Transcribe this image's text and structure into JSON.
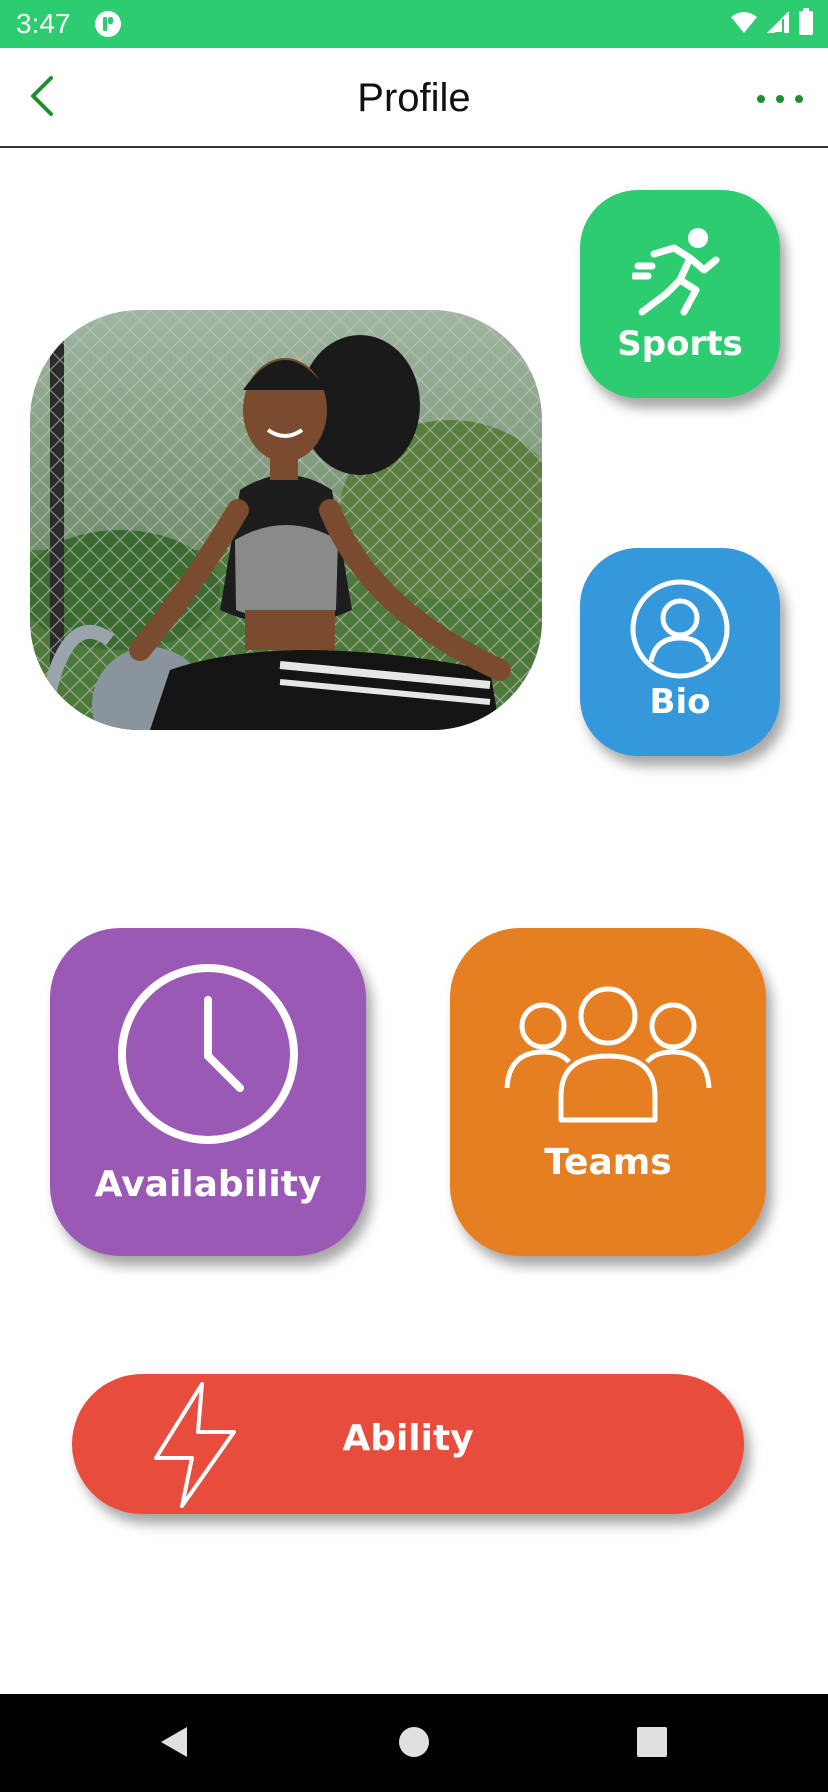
{
  "status_bar": {
    "time": "3:47",
    "bg_color": "#2ecc71",
    "icons": [
      "app-notification-icon",
      "wifi-icon",
      "cellular-signal-icon",
      "battery-icon"
    ]
  },
  "app_bar": {
    "title": "Profile",
    "back_icon": "chevron-left-icon",
    "menu_icon": "more-horizontal-icon",
    "accent_color": "#1e8f2e"
  },
  "profile": {
    "photo": "athlete-profile-photo"
  },
  "tiles": {
    "sports": {
      "label": "Sports",
      "color": "#2ecc71",
      "icon": "running-person-icon"
    },
    "bio": {
      "label": "Bio",
      "color": "#3498db",
      "icon": "user-circle-icon"
    },
    "availability": {
      "label": "Availability",
      "color": "#9b59b6",
      "icon": "clock-icon"
    },
    "teams": {
      "label": "Teams",
      "color": "#e67e22",
      "icon": "group-icon"
    },
    "ability": {
      "label": "Ability",
      "color": "#e74c3c",
      "icon": "lightning-bolt-icon"
    }
  },
  "nav_bar": {
    "buttons": [
      "back-triangle-icon",
      "home-circle-icon",
      "recents-square-icon"
    ]
  }
}
